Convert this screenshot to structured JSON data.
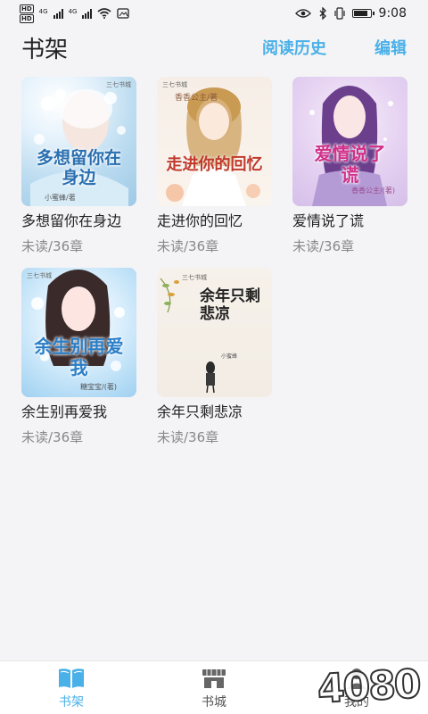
{
  "status_bar": {
    "hd1": "HD",
    "hd2": "HD",
    "net1": "4G",
    "net2": "4G",
    "time": "9:08"
  },
  "header": {
    "title": "书架",
    "history_label": "阅读历史",
    "edit_label": "编辑"
  },
  "books": [
    {
      "title": "多想留你在身边",
      "progress": "未读/36章",
      "cover_text": "多想留你在身边",
      "cover_author": "小蜜蜂/著"
    },
    {
      "title": "走进你的回忆",
      "progress": "未读/36章",
      "cover_text": "走进你的回忆",
      "cover_author": "香香公主/著"
    },
    {
      "title": "爱情说了谎",
      "progress": "未读/36章",
      "cover_text": "爱情说了谎",
      "cover_author": "香香公主/(著)"
    },
    {
      "title": "余生别再爱我",
      "progress": "未读/36章",
      "cover_text": "余生别再爱我",
      "cover_author": "糖宝宝/(著)"
    },
    {
      "title": "余年只剩悲凉",
      "progress": "未读/36章",
      "cover_text": "余年只剩悲凉",
      "cover_author": "小蜜蜂"
    }
  ],
  "tabs": [
    {
      "label": "书架",
      "icon": "book-open-icon",
      "active": true
    },
    {
      "label": "书城",
      "icon": "store-icon",
      "active": false
    },
    {
      "label": "我的",
      "icon": "person-icon",
      "active": false
    }
  ],
  "watermark": "4080",
  "colors": {
    "accent": "#4ab0e8",
    "background": "#f4f4f6",
    "text": "#222222",
    "muted": "#888888"
  }
}
